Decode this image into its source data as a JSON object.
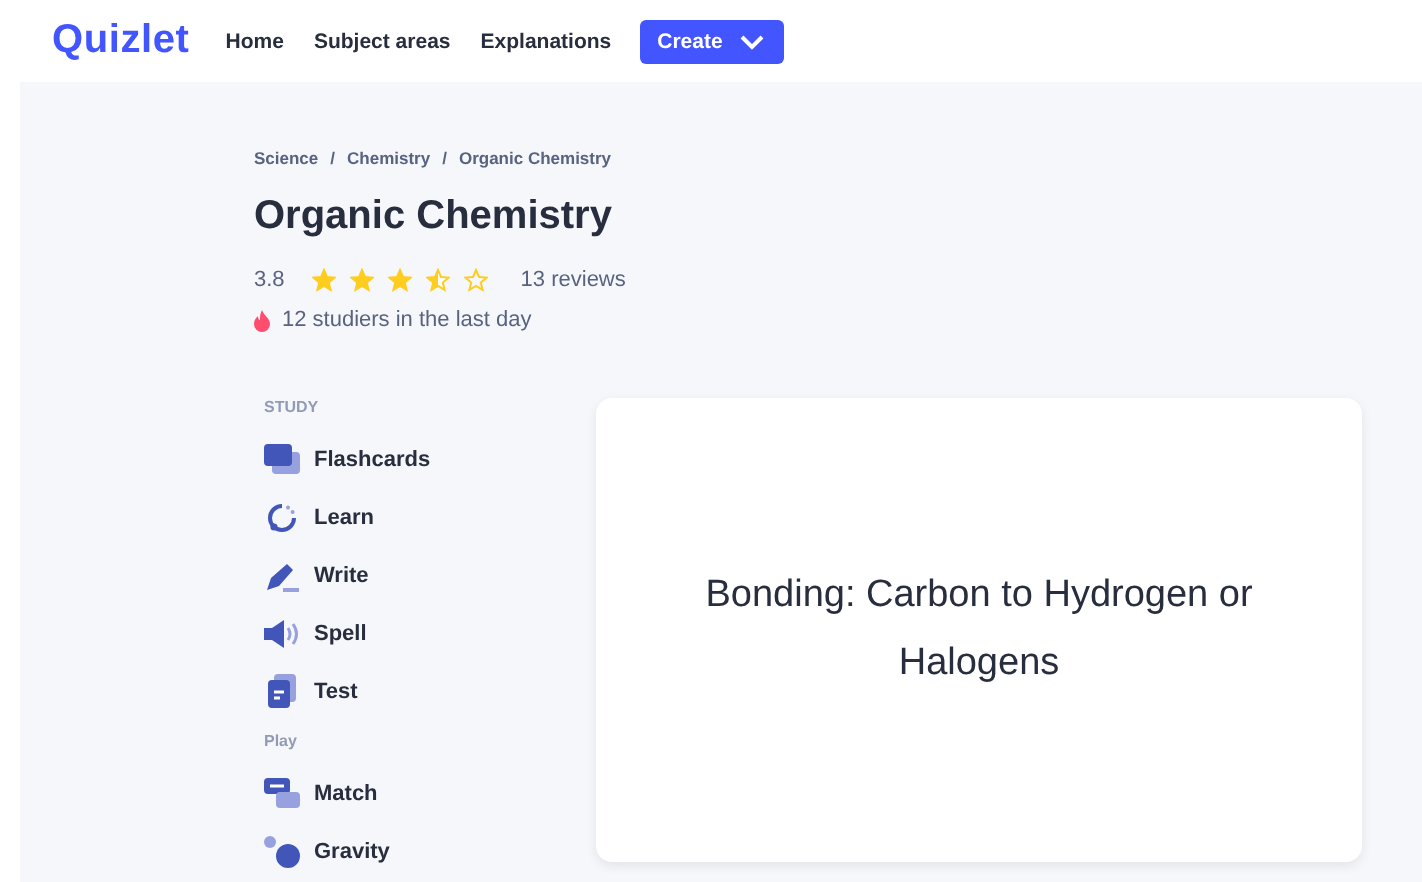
{
  "header": {
    "logo": "Quizlet",
    "nav": [
      "Home",
      "Subject areas",
      "Explanations"
    ],
    "create_button": "Create"
  },
  "breadcrumbs": [
    "Science",
    "Chemistry",
    "Organic Chemistry"
  ],
  "breadcrumb_separator": "/",
  "title": "Organic Chemistry",
  "rating": {
    "score": "3.8",
    "stars": 3.5,
    "reviews": "13 reviews"
  },
  "studiers": "12 studiers in the last day",
  "sections": [
    {
      "heading": "STUDY",
      "items": [
        {
          "label": "Flashcards",
          "kind": "flashcards"
        },
        {
          "label": "Learn",
          "kind": "learn"
        },
        {
          "label": "Write",
          "kind": "write"
        },
        {
          "label": "Spell",
          "kind": "spell"
        },
        {
          "label": "Test",
          "kind": "test"
        }
      ]
    },
    {
      "heading": "Play",
      "items": [
        {
          "label": "Match",
          "kind": "match"
        },
        {
          "label": "Gravity",
          "kind": "gravity"
        }
      ]
    }
  ],
  "card": {
    "text": "Bonding: Carbon to Hydrogen or Halogens"
  }
}
